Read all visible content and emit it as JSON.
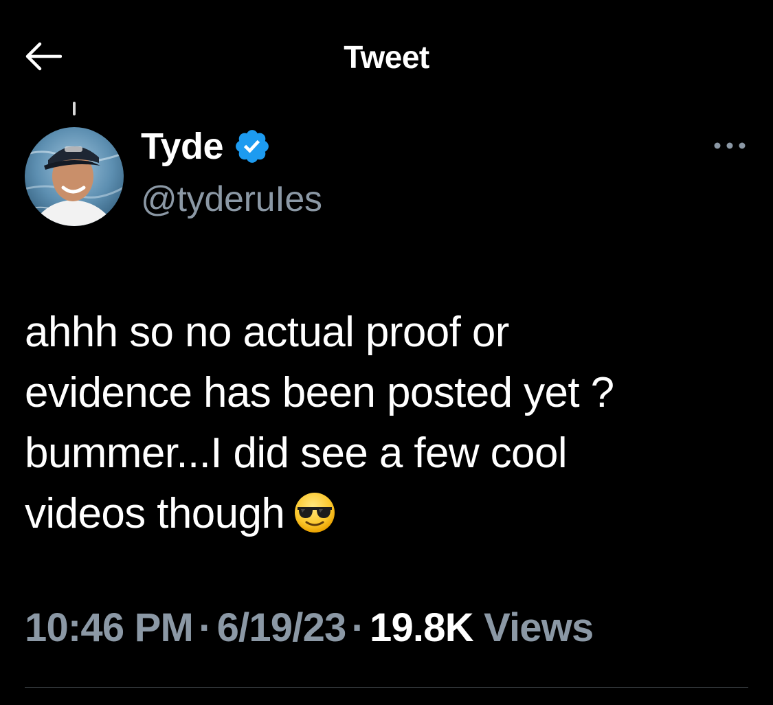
{
  "header": {
    "title": "Tweet",
    "back_icon": "arrow-left-icon"
  },
  "author": {
    "display_name": "Tyde",
    "handle": "@tyderuIes",
    "verified": true,
    "verified_icon": "verified-badge-icon",
    "verified_color": "#1d9bf0"
  },
  "menu_icon": "more-horizontal-icon",
  "tweet": {
    "lines": [
      "ahhh so no actual proof or",
      "evidence has been posted yet ?",
      "bummer...I did see a few cool",
      "videos though"
    ],
    "emoji": "smiling-face-with-sunglasses-emoji"
  },
  "meta": {
    "time": "10:46 PM",
    "separator": "·",
    "date": "6/19/23",
    "views_count": "19.8K",
    "views_label": "Views"
  },
  "colors": {
    "background": "#000000",
    "text_primary": "#ffffff",
    "text_secondary": "#8b98a5",
    "divider": "#2f3336"
  }
}
